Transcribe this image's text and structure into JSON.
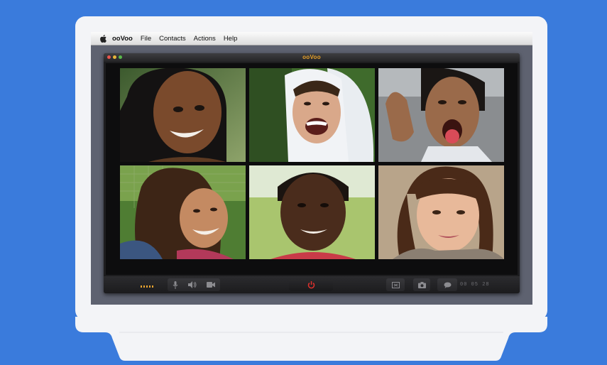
{
  "menubar": {
    "app_name": "ooVoo",
    "items": [
      "File",
      "Contacts",
      "Actions",
      "Help"
    ]
  },
  "window": {
    "title": "ooVoo"
  },
  "video_tiles": [
    {
      "participant": "participant-1"
    },
    {
      "participant": "participant-2"
    },
    {
      "participant": "participant-3"
    },
    {
      "participant": "participant-4"
    },
    {
      "participant": "participant-5"
    },
    {
      "participant": "participant-6"
    }
  ],
  "controls": {
    "call_timer": "00 05 28",
    "icons": [
      "microphone-icon",
      "speaker-icon",
      "camera-icon",
      "power-icon",
      "screen-share-icon",
      "snapshot-icon",
      "chat-icon"
    ]
  },
  "colors": {
    "background": "#3a7bdc",
    "brand": "#e8a128",
    "end_call": "#e0302c"
  }
}
